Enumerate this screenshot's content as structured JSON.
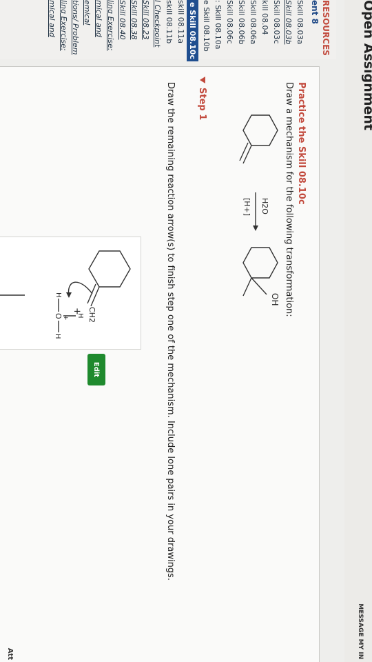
{
  "window": {
    "title": "Open Assignment",
    "message_button": "MESSAGE MY IN"
  },
  "sidebar": {
    "heading": "RESOURCES",
    "subheading": "ent 8",
    "items": [
      {
        "label": "Skill 08.03a",
        "style": "plain"
      },
      {
        "label": "Skill 08.03b",
        "style": "link"
      },
      {
        "label": "Skill 08.03c",
        "style": "plain"
      },
      {
        "label": "kill 08.04",
        "style": "plain"
      },
      {
        "label": "Skill 08.06a",
        "style": "plain"
      },
      {
        "label": "Skill 08.06b",
        "style": "plain"
      },
      {
        "label": "Skill 08.06c",
        "style": "plain"
      },
      {
        "label": ": Skill 08.10a",
        "style": "plain"
      },
      {
        "label": "e Skill 08.10b",
        "style": "plain"
      },
      {
        "label": "e Skill 08.10c",
        "style": "selected"
      },
      {
        "label": "skill 08.11a",
        "style": "plain"
      },
      {
        "label": "skill 08.11b",
        "style": "plain"
      },
      {
        "label": "l Checkpoint",
        "style": "link"
      },
      {
        "label": "Skill 08.23",
        "style": "link"
      },
      {
        "label": "Skill 08.38",
        "style": "link"
      },
      {
        "label": "Skill 08.40",
        "style": "link"
      },
      {
        "label": "ling Exercise:",
        "style": "link"
      },
      {
        "label": "mical and",
        "style": "link"
      },
      {
        "label": "emical",
        "style": "link"
      },
      {
        "label": "tions/ Problem",
        "style": "link"
      },
      {
        "label": "ling Exercise:",
        "style": "link"
      },
      {
        "label": "mical and",
        "style": "link"
      }
    ]
  },
  "practice": {
    "title": "Practice the Skill 08.10c",
    "description": "Draw a mechanism for the following transformation:",
    "reagent_top": "H2O",
    "reagent_bottom": "[H+]",
    "product_label": "OH"
  },
  "step": {
    "title": "Step 1",
    "description": "Draw the remaining reaction arrow(s) to finish step one of the mechanism. Include lone pairs in your drawings.",
    "labels": {
      "ch2": "CH2",
      "plus": "+",
      "h_top": "H",
      "h_left": "H",
      "o": "O",
      "o_plus": "+",
      "h_right": "H"
    },
    "edit_button": "Edit"
  },
  "footer": {
    "attempt": "Att"
  }
}
